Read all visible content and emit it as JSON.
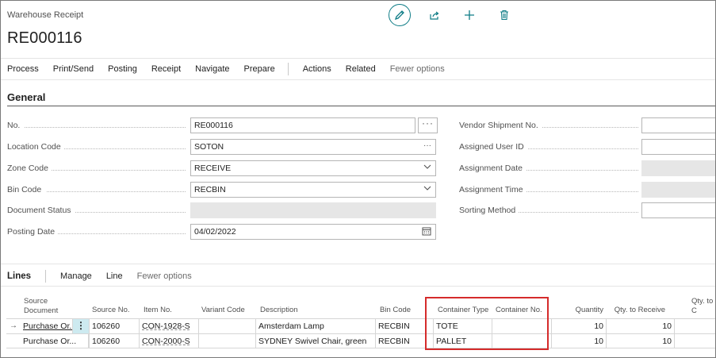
{
  "header": {
    "breadcrumb": "Warehouse Receipt",
    "record_no": "RE000116",
    "icons": [
      "edit-icon",
      "share-icon",
      "add-icon",
      "delete-icon"
    ]
  },
  "actionbar": {
    "process": "Process",
    "print_send": "Print/Send",
    "posting": "Posting",
    "receipt": "Receipt",
    "navigate": "Navigate",
    "prepare": "Prepare",
    "actions": "Actions",
    "related": "Related",
    "fewer_options": "Fewer options"
  },
  "general": {
    "title": "General",
    "no_label": "No.",
    "no_value": "RE000116",
    "location_label": "Location Code",
    "location_value": "SOTON",
    "zone_label": "Zone Code",
    "zone_value": "RECEIVE",
    "bin_label": "Bin Code",
    "bin_value": "RECBIN",
    "docstatus_label": "Document Status",
    "docstatus_value": "",
    "posting_label": "Posting Date",
    "posting_value": "04/02/2022",
    "vendor_label": "Vendor Shipment No.",
    "vendor_value": "",
    "user_label": "Assigned User ID",
    "user_value": "",
    "assign_date_label": "Assignment Date",
    "assign_time_label": "Assignment Time",
    "sorting_label": "Sorting Method",
    "sorting_value": ""
  },
  "lines": {
    "title": "Lines",
    "manage": "Manage",
    "line": "Line",
    "fewer_options": "Fewer options",
    "columns": {
      "source_doc": "Source\nDocument",
      "source_no": "Source No.",
      "item_no": "Item No.",
      "variant": "Variant Code",
      "description": "Description",
      "bin": "Bin Code",
      "container_type": "Container Type",
      "container_no": "Container No.",
      "quantity": "Quantity",
      "qty_to_receive": "Qty. to Receive",
      "qty_to_cross": "Qty. to C"
    },
    "rows": [
      {
        "source_doc": "Purchase Or...",
        "source_no": "106260",
        "item_no": "CON-1928-S",
        "variant": "",
        "description": "Amsterdam Lamp",
        "bin": "RECBIN",
        "container_type": "TOTE",
        "container_no": "",
        "quantity": "10",
        "qty_to_receive": "10"
      },
      {
        "source_doc": "Purchase Or...",
        "source_no": "106260",
        "item_no": "CON-2000-S",
        "variant": "",
        "description": "SYDNEY Swivel Chair, green",
        "bin": "RECBIN",
        "container_type": "PALLET",
        "container_no": "",
        "quantity": "10",
        "qty_to_receive": "10"
      }
    ]
  },
  "colors": {
    "accent": "#0e7c86",
    "highlight": "#d52b2b",
    "row_action": "#cdeaf0"
  }
}
